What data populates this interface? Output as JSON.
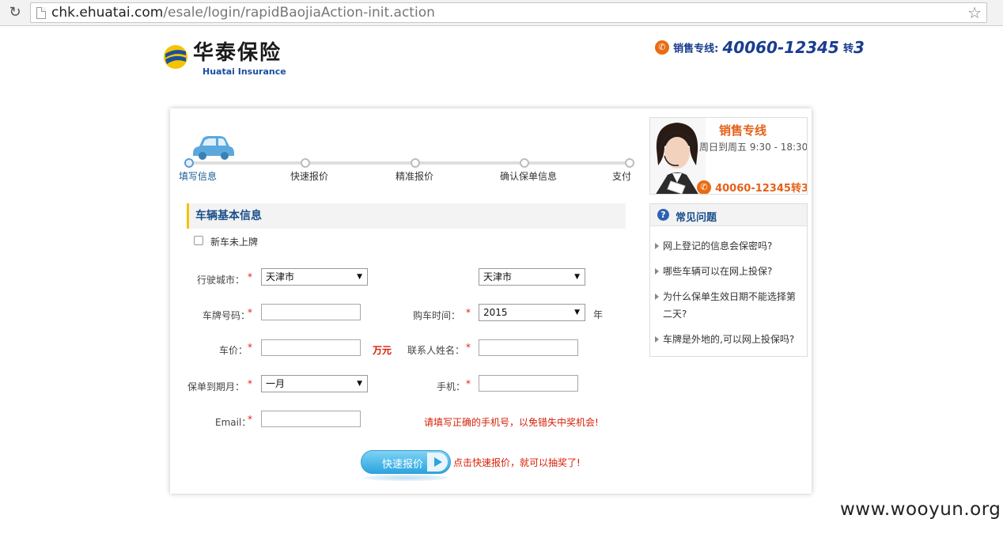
{
  "browser": {
    "url_host": "chk.ehuatai.com",
    "url_path": "/esale/login/rapidBaojiaAction-init.action"
  },
  "header": {
    "logo_cn": "华泰保险",
    "logo_en": "Huatai Insurance",
    "hotline_label": "销售专线:",
    "hotline_number": "40060-12345",
    "hotline_ext_label": "转",
    "hotline_ext": "3"
  },
  "progress": {
    "steps": [
      "填写信息",
      "快速报价",
      "精准报价",
      "确认保单信息",
      "支付"
    ],
    "current_step": 1
  },
  "form": {
    "section_title": "车辆基本信息",
    "new_car_label": "新车未上牌",
    "new_car_checked": false,
    "city_label": "行驶城市：",
    "city_value": "天津市",
    "city2_value": "天津市",
    "plate_label": "车牌号码：",
    "plate_value": "",
    "purchase_time_label": "购车时间：",
    "purchase_year": "2015",
    "year_unit": "年",
    "price_label": "车价：",
    "price_value": "",
    "price_unit": "万元",
    "contact_label": "联系人姓名：",
    "contact_value": "",
    "policy_month_label": "保单到期月：",
    "policy_month_value": "一月",
    "phone_label": "手机：",
    "phone_value": "",
    "email_label": "Email：",
    "email_value": "",
    "required_mark": "*",
    "phone_tip": "请填写正确的手机号，以免错失中奖机会!",
    "quote_button": "快速报价",
    "quote_tip": "点击快速报价，就可以抽奖了!"
  },
  "sidebar": {
    "sales_title": "销售专线",
    "sales_hours": "周日到周五 9:30 - 18:30",
    "sales_phone": "40060-12345转3",
    "faq_title": "常见问题",
    "faq_items": [
      "网上登记的信息会保密吗?",
      "哪些车辆可以在网上投保?",
      "为什么保单生效日期不能选择第二天?",
      "车牌是外地的,可以网上投保吗?"
    ]
  },
  "watermark": "www.wooyun.org",
  "colors": {
    "brand_blue": "#1a3d8f",
    "accent_orange": "#e4621a",
    "required_red": "#e02020",
    "button_blue": "#2aa5e0"
  }
}
